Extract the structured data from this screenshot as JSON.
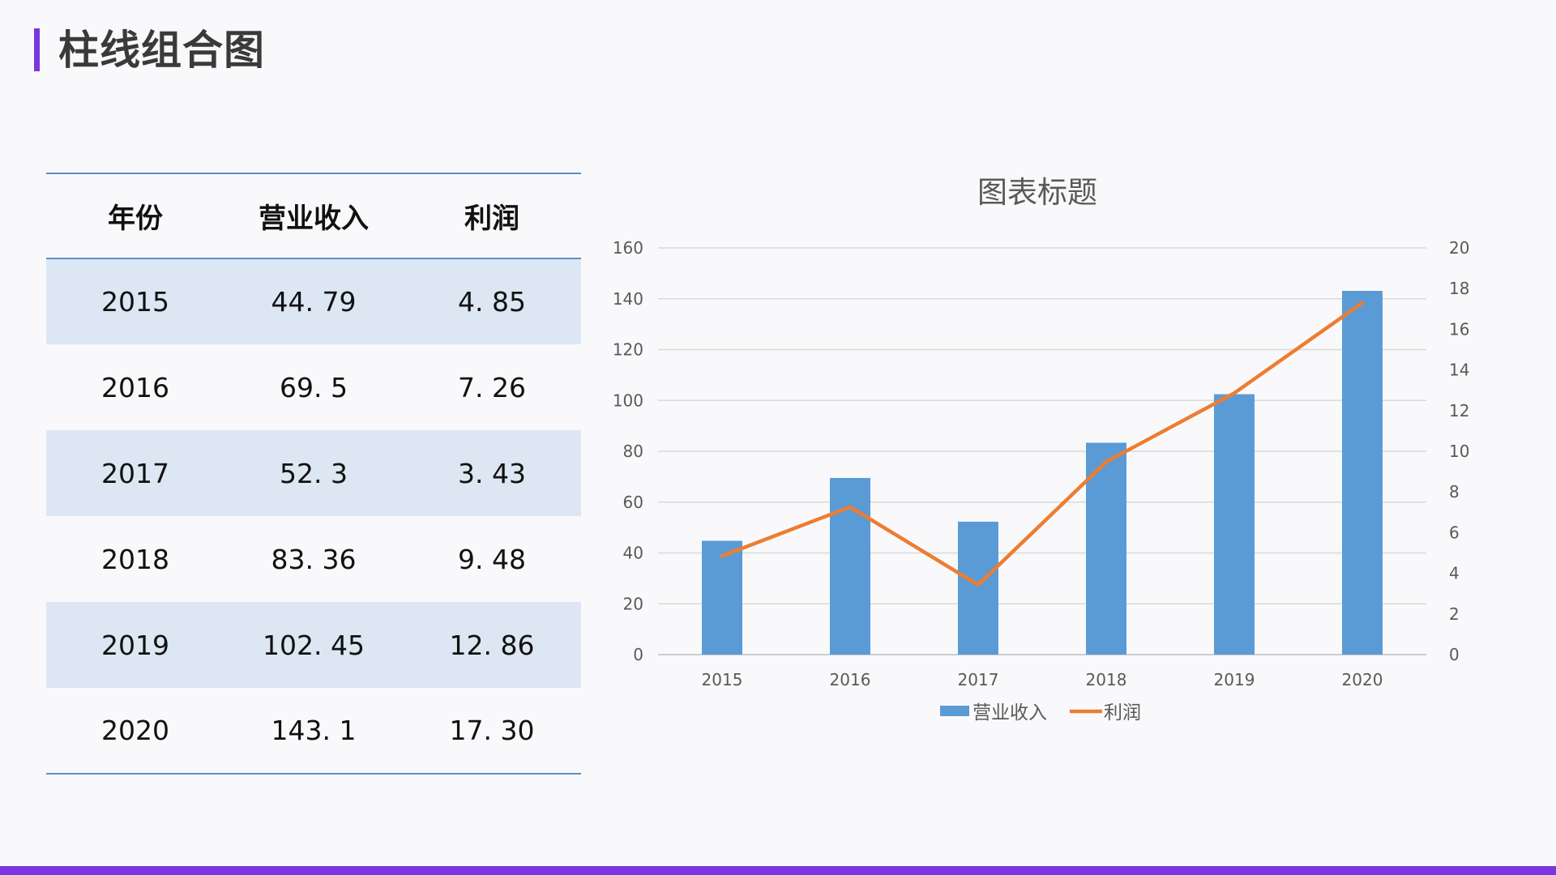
{
  "page": {
    "title": "柱线组合图",
    "accent_color": "#7b35e0"
  },
  "table": {
    "headers": [
      "年份",
      "营业收入",
      "利润"
    ],
    "rows": [
      [
        "2015",
        "44. 79",
        "4. 85"
      ],
      [
        "2016",
        "69. 5",
        "7. 26"
      ],
      [
        "2017",
        "52. 3",
        "3. 43"
      ],
      [
        "2018",
        "83. 36",
        "9. 48"
      ],
      [
        "2019",
        "102. 45",
        "12. 86"
      ],
      [
        "2020",
        "143. 1",
        "17. 30"
      ]
    ],
    "shade_color": "#dce7f3",
    "rule_color": "#5b8fc9"
  },
  "chart_data": {
    "type": "bar",
    "title": "图表标题",
    "categories": [
      "2015",
      "2016",
      "2017",
      "2018",
      "2019",
      "2020"
    ],
    "series": [
      {
        "name": "营业收入",
        "type": "bar",
        "axis": "left",
        "color": "#5b9bd5",
        "values": [
          44.79,
          69.5,
          52.3,
          83.36,
          102.45,
          143.1
        ]
      },
      {
        "name": "利润",
        "type": "line",
        "axis": "right",
        "color": "#ed7d31",
        "values": [
          4.85,
          7.26,
          3.43,
          9.48,
          12.86,
          17.3
        ]
      }
    ],
    "ylim": [
      0,
      160
    ],
    "yticks": [
      "0",
      "20",
      "40",
      "60",
      "80",
      "100",
      "120",
      "140",
      "160"
    ],
    "y2lim": [
      0,
      20
    ],
    "y2ticks": [
      "0",
      "2",
      "4",
      "6",
      "8",
      "10",
      "12",
      "14",
      "16",
      "18",
      "20"
    ],
    "grid": true,
    "legend": "bottom"
  }
}
